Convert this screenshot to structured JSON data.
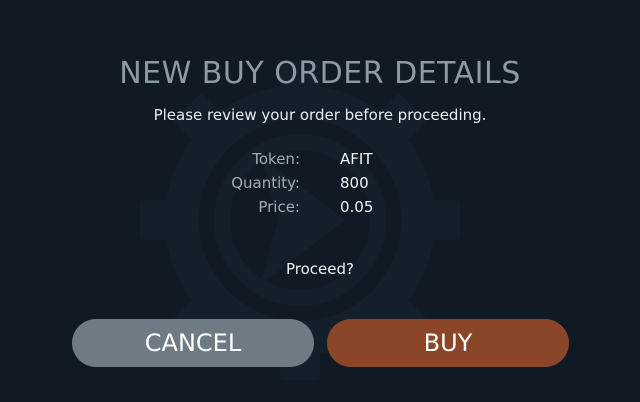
{
  "dialog": {
    "title": "NEW BUY ORDER DETAILS",
    "subtitle": "Please review your order before proceeding.",
    "details": [
      {
        "label": "Token:",
        "value": "AFIT"
      },
      {
        "label": "Quantity:",
        "value": "800"
      },
      {
        "label": "Price:",
        "value": "0.05"
      }
    ],
    "prompt": "Proceed?",
    "cancel_label": "CANCEL",
    "buy_label": "BUY"
  },
  "colors": {
    "background": "#0f1a24",
    "cancel_button": "#6e7a84",
    "buy_button": "#8b462a",
    "title": "#8c9aa6"
  },
  "background_icon": "gear-icon"
}
